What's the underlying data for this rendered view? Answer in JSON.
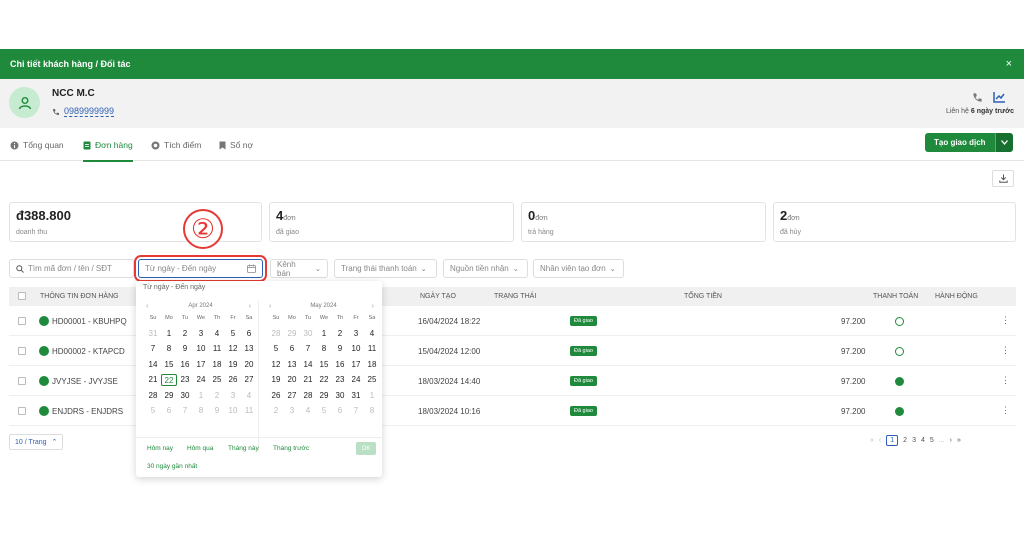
{
  "header": {
    "title": "Chi tiết khách hàng / Đối tác",
    "close": "×"
  },
  "profile": {
    "name": "NCC M.C",
    "phone": "0989999999",
    "contact_prefix": "Liên hệ",
    "contact_time": "6 ngày trước"
  },
  "tabs": [
    {
      "label": "Tổng quan",
      "icon": "info-icon"
    },
    {
      "label": "Đơn hàng",
      "icon": "document-icon"
    },
    {
      "label": "Tích điểm",
      "icon": "coin-icon"
    },
    {
      "label": "Sổ nợ",
      "icon": "bookmark-icon"
    }
  ],
  "create_button": "Tạo giao dịch",
  "stats": [
    {
      "value": "đ388.800",
      "unit": "",
      "label": "doanh thu"
    },
    {
      "value": "4",
      "unit": "đơn",
      "label": "đã giao"
    },
    {
      "value": "0",
      "unit": "đơn",
      "label": "trả hàng"
    },
    {
      "value": "2",
      "unit": "đơn",
      "label": "đã hủy"
    }
  ],
  "filters": {
    "search_placeholder": "Tìm mã đơn / tên / SĐT",
    "date_placeholder": "Từ ngày - Đến ngày",
    "channel": "Kênh bán",
    "payment_status": "Trạng thái thanh toán",
    "money_source": "Nguồn tiền nhận",
    "creator": "Nhân viên tạo đơn"
  },
  "annotation": "②",
  "table": {
    "headers": {
      "order_info": "THÔNG TIN ĐƠN HÀNG",
      "date": "NGÀY TẠO",
      "status": "TRẠNG THÁI",
      "total": "TỔNG TIỀN",
      "payment": "THANH TOÁN",
      "action": "HÀNH ĐỘNG"
    },
    "rows": [
      {
        "code": "HD00001 - KBUHPQ",
        "date": "16/04/2024 18:22",
        "status": "Đã giao",
        "total": "97.200",
        "paid": false
      },
      {
        "code": "HD00002 - KTAPCD",
        "date": "15/04/2024 12:00",
        "status": "Đã giao",
        "total": "97.200",
        "paid": false
      },
      {
        "code": "JVYJSE - JVYJSE",
        "date": "18/03/2024 14:40",
        "status": "Đã giao",
        "total": "97.200",
        "paid": true
      },
      {
        "code": "ENJDRS - ENJDRS",
        "date": "18/03/2024 10:16",
        "status": "Đã giao",
        "total": "97.200",
        "paid": true
      }
    ]
  },
  "pagination": {
    "per_page": "10 / Trang",
    "pages": [
      "1",
      "2",
      "3",
      "4",
      "5",
      "..."
    ],
    "current": "1"
  },
  "calendar": {
    "range_text": "Từ ngày - Đến ngày",
    "weekdays": [
      "Su",
      "Mo",
      "Tu",
      "We",
      "Th",
      "Fr",
      "Sa"
    ],
    "left": {
      "title": "Apr 2024",
      "days": [
        "31",
        "1",
        "2",
        "3",
        "4",
        "5",
        "6",
        "7",
        "8",
        "9",
        "10",
        "11",
        "12",
        "13",
        "14",
        "15",
        "16",
        "17",
        "18",
        "19",
        "20",
        "21",
        "22",
        "23",
        "24",
        "25",
        "26",
        "27",
        "28",
        "29",
        "30",
        "1",
        "2",
        "3",
        "4",
        "5",
        "6",
        "7",
        "8",
        "9",
        "10",
        "11"
      ],
      "other_month_index": [
        0,
        31,
        32,
        33,
        34,
        35,
        36,
        37,
        38,
        39,
        40,
        41
      ],
      "today_index": 22
    },
    "right": {
      "title": "May 2024",
      "days": [
        "28",
        "29",
        "30",
        "1",
        "2",
        "3",
        "4",
        "5",
        "6",
        "7",
        "8",
        "9",
        "10",
        "11",
        "12",
        "13",
        "14",
        "15",
        "16",
        "17",
        "18",
        "19",
        "20",
        "21",
        "22",
        "23",
        "24",
        "25",
        "26",
        "27",
        "28",
        "29",
        "30",
        "31",
        "1",
        "2",
        "3",
        "4",
        "5",
        "6",
        "7",
        "8"
      ],
      "other_month_index": [
        0,
        1,
        2,
        34,
        35,
        36,
        37,
        38,
        39,
        40,
        41
      ],
      "today_index": -1
    },
    "shortcuts": [
      "Hôm nay",
      "Hôm qua",
      "Tháng này",
      "Tháng trước",
      "30 ngày gần nhất"
    ],
    "ok": "OK"
  }
}
